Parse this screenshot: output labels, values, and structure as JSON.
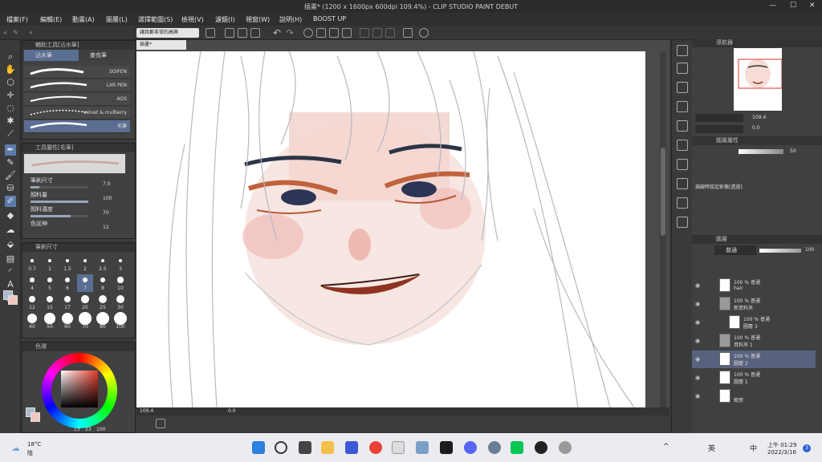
{
  "titlebar": {
    "text": "插畫* (1200 x 1600px 600dpi 109.4%)  - CLIP STUDIO PAINT DEBUT",
    "min": "—",
    "max": "☐",
    "close": "✕"
  },
  "menu": [
    "檔案(F)",
    "編輯(E)",
    "動畫(A)",
    "圖層(L)",
    "選擇範圍(S)",
    "檢視(V)",
    "濾鏡(I)",
    "視窗(W)",
    "說明(H)",
    "BOOST UP"
  ],
  "command_bar": {
    "tooltip_button": "讓我都非常的高興"
  },
  "tool_panel": {
    "subtool_title": "輔助工具[沾水筆]",
    "tabs": [
      "沾水筆",
      "麥克筆"
    ],
    "brushes": [
      "SOIFEN",
      "LXR PEN",
      "AOS",
      "velvet & mulberry",
      "毛筆"
    ]
  },
  "tool_property": {
    "title": "工具屬性[毛筆]",
    "rows": [
      {
        "label": "筆刷尺寸",
        "value": "7.0",
        "fill": 0.15
      },
      {
        "label": "顏料量",
        "value": "100",
        "fill": 1.0
      },
      {
        "label": "顏料濃度",
        "value": "70",
        "fill": 0.7
      },
      {
        "label": "色延伸",
        "value": "12",
        "fill": 0.12
      }
    ]
  },
  "brush_size": {
    "title": "筆刷尺寸",
    "sizes": [
      "0.7",
      "1",
      "1.5",
      "2",
      "2.5",
      "3",
      "4",
      "5",
      "6",
      "7",
      "8",
      "10",
      "12",
      "15",
      "17",
      "20",
      "25",
      "30",
      "40",
      "50",
      "60",
      "70",
      "80",
      "100"
    ],
    "selected": "7"
  },
  "color_panel": {
    "title": "色環",
    "readout": [
      "13",
      "23",
      "100"
    ]
  },
  "canvas": {
    "tab_label": "插畫*",
    "zoom": "109.4",
    "rotation": "0.0"
  },
  "navigator": {
    "title": "導航器",
    "zoom": "109.4",
    "rotation": "0.0"
  },
  "layer_property": {
    "title": "圖層屬性",
    "hint": "描線時設定影像[透過]",
    "value": "50"
  },
  "layers_panel": {
    "title": "圖層",
    "blend_mode": "普通",
    "opacity": "100",
    "items": [
      {
        "l1": "100 % 普通",
        "l2": "hair",
        "selected": false,
        "folder": false,
        "indent": 0
      },
      {
        "l1": "100 % 普通",
        "l2": "新資料夾",
        "selected": false,
        "folder": true,
        "indent": 0
      },
      {
        "l1": "100 % 普通",
        "l2": "圖層 3",
        "selected": false,
        "folder": false,
        "indent": 1
      },
      {
        "l1": "100 % 普通",
        "l2": "資料夾 1",
        "selected": false,
        "folder": true,
        "indent": 0
      },
      {
        "l1": "100 % 普通",
        "l2": "圖層 2",
        "selected": true,
        "folder": false,
        "indent": 0
      },
      {
        "l1": "100 % 普通",
        "l2": "圖層 1",
        "selected": false,
        "folder": false,
        "indent": 0
      },
      {
        "l1": "",
        "l2": "紙張",
        "selected": false,
        "folder": false,
        "indent": 0
      }
    ]
  },
  "taskbar": {
    "weather_temp": "18°C",
    "weather_desc": "陰",
    "time": "上午 01:29",
    "date": "2022/3/16",
    "ime": "英",
    "ime2": "中",
    "notification_count": "3"
  },
  "colors": {
    "accent": "#5d7ba8",
    "panel": "#414141",
    "taskbar": "#ecebf2"
  }
}
